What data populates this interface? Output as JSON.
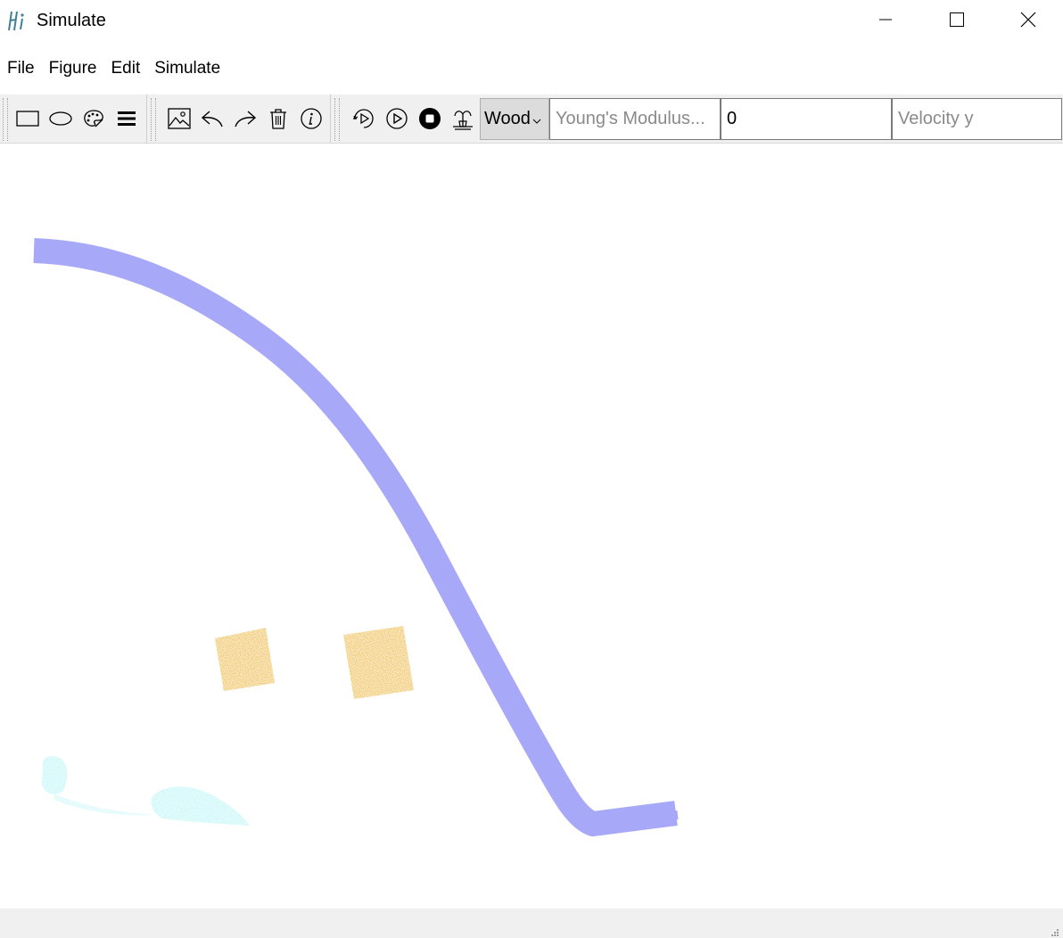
{
  "window": {
    "title": "Simulate",
    "app_icon": "hi-logo-icon",
    "controls": [
      "minimize-icon",
      "maximize-icon",
      "close-icon"
    ]
  },
  "menu": {
    "items": [
      "File",
      "Figure",
      "Edit",
      "Simulate"
    ]
  },
  "toolbar": {
    "shape_tools": [
      "rectangle-icon",
      "ellipse-icon",
      "palette-icon",
      "hamburger-icon"
    ],
    "edit_tools": [
      "image-icon",
      "undo-icon",
      "redo-icon",
      "trash-icon",
      "info-icon"
    ],
    "sim_tools": [
      "step-play-icon",
      "play-icon",
      "stop-icon",
      "fountain-icon"
    ],
    "material": "Wood",
    "youngs_modulus_placeholder": "Young's Modulus...",
    "velocity_x_value": "0",
    "velocity_y_placeholder": "Velocity y"
  },
  "scene": {
    "objects": [
      {
        "name": "elastic-ribbon",
        "color": "#a8a8f8"
      },
      {
        "name": "wood-block-left",
        "color": "#e8a71a"
      },
      {
        "name": "wood-block-right",
        "color": "#e8a71a"
      },
      {
        "name": "water-particles",
        "color": "#a8f2f4"
      }
    ]
  },
  "colors": {
    "toolbar_bg": "#f0f0f0",
    "statusbar_bg": "#f0f0f0",
    "ribbon": "#a8a8f8",
    "wood": "#e8a71a",
    "water": "#a8f2f4"
  }
}
